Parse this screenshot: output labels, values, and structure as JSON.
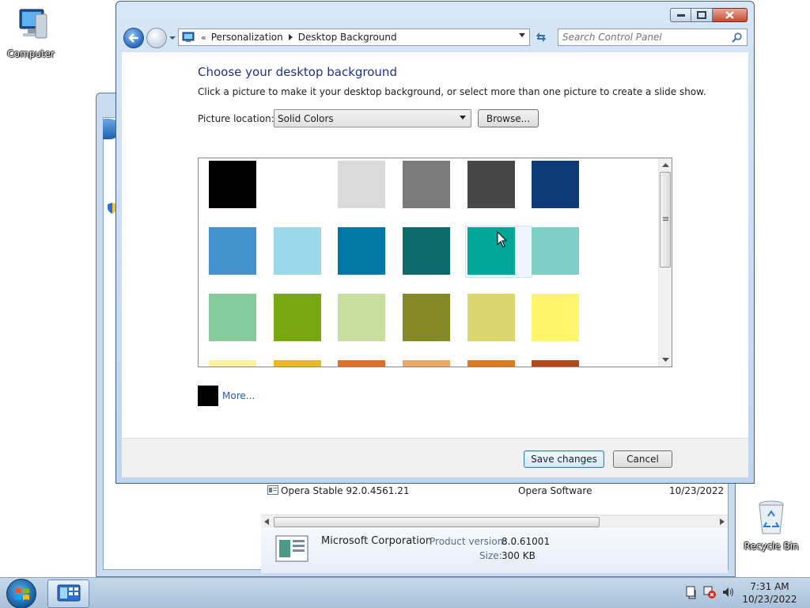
{
  "desktop": {
    "computer_label": "Computer",
    "recycle_label": "Recycle Bin"
  },
  "background_window": {
    "row": {
      "name": "Opera Stable 92.0.4561.21",
      "publisher": "Opera Software",
      "date": "10/23/2022"
    },
    "details": {
      "publisher": "Microsoft Corporation",
      "version_label": "Product version:",
      "version_value": "8.0.61001",
      "size_label": "Size:",
      "size_value": "300 KB"
    }
  },
  "main_window": {
    "address": {
      "overflow": "«",
      "crumbs": [
        "Personalization",
        "Desktop Background"
      ]
    },
    "search": {
      "placeholder": "Search Control Panel"
    },
    "heading": "Choose your desktop background",
    "subtext": "Click a picture to make it your desktop background, or select more than one picture to create a slide show.",
    "picture_location_label": "Picture location:",
    "picture_location_value": "Solid Colors",
    "browse_label": "Browse...",
    "swatches": [
      [
        "#000000",
        "#ffffff",
        "#dadada",
        "#7a7a7a",
        "#474747",
        "#0c3b77"
      ],
      [
        "#4392d0",
        "#9bd9ea",
        "#0077a5",
        "#0d6b6b",
        "#00a799",
        "#7ecfc8"
      ],
      [
        "#86cb9c",
        "#78a810",
        "#c7de9e",
        "#858925",
        "#dcd66f",
        "#fff56b"
      ],
      [
        "#fff0a0",
        "#f0b820",
        "#e07028",
        "#f0a860",
        "#e07818",
        "#b84818"
      ]
    ],
    "selected_swatch": "#00a799",
    "more_swatch_color": "#000000",
    "more_link": "More...",
    "save_label": "Save changes",
    "cancel_label": "Cancel"
  },
  "taskbar": {
    "time": "7:31 AM",
    "date": "10/23/2022"
  },
  "colors": {
    "link": "#1f5fb4",
    "heading": "#1e3287"
  }
}
